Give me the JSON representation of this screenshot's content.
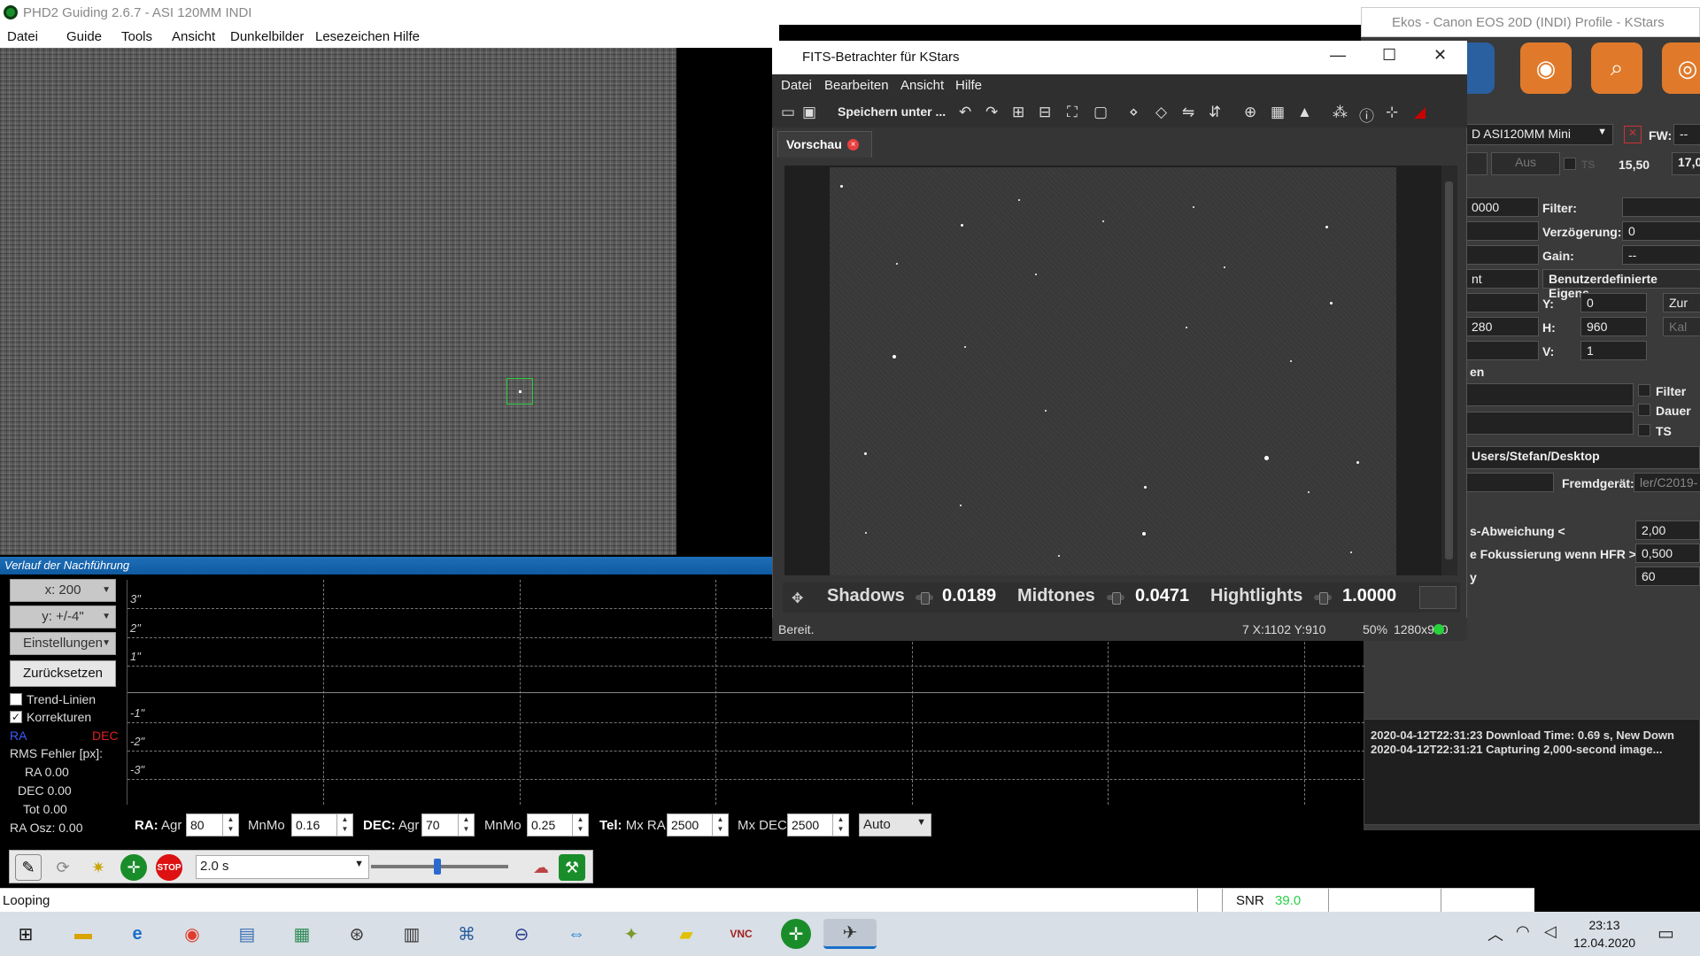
{
  "phd": {
    "title": "PHD2 Guiding 2.6.7 - ASI 120MM INDI",
    "menu": [
      "Datei",
      "Guide",
      "Tools",
      "Ansicht",
      "Dunkelbilder",
      "Lesezeichen",
      "Hilfe"
    ],
    "history_title": "Verlauf der Nachführung",
    "x_scale": "x: 200",
    "y_scale": "y: +/-4\"",
    "settings": "Einstellungen",
    "reset": "Zurücksetzen",
    "trend_lines": "Trend-Linien",
    "corrections": "Korrekturen",
    "ra_label": "RA",
    "dec_label": "DEC",
    "rms_label": "RMS Fehler [px]:",
    "rms_ra": "RA 0.00",
    "rms_dec": "DEC 0.00",
    "rms_tot": "Tot 0.00",
    "ra_osc": "RA Osz: 0.00",
    "y_ticks": [
      "3\"",
      "2\"",
      "1\"",
      "-1\"",
      "-2\"",
      "-3\""
    ],
    "params": {
      "ra": "RA:",
      "agr": "Agr",
      "ra_agr": "80",
      "mnmo": "MnMo",
      "ra_mnmo": "0.16",
      "dec": "DEC:",
      "dec_agr": "70",
      "dec_mnmo": "0.25",
      "tel": "Tel:",
      "mxra": "Mx RA",
      "mxra_val": "2500",
      "mxdec": "Mx DEC",
      "mxdec_val": "2500",
      "mode": "Auto"
    },
    "exposure": "2.0 s",
    "status": "Looping",
    "snr_label": "SNR",
    "snr_value": "39.0",
    "colors": {
      "ra": "#3b5bff",
      "dec": "#e02020",
      "snr": "#2bd14a"
    }
  },
  "fits": {
    "title": "FITS-Betrachter für KStars",
    "menu": [
      "Datei",
      "Bearbeiten",
      "Ansicht",
      "Hilfe"
    ],
    "save_as": "Speichern unter ...",
    "tab": "Vorschau",
    "shadows_label": "Shadows",
    "shadows": "0.0189",
    "midtones_label": "Midtones",
    "midtones": "0.0471",
    "highlights_label": "Hightlights",
    "highlights": "1.0000",
    "status_ready": "Bereit.",
    "status_coords": "7  X:1102 Y:910",
    "status_zoom": "50%",
    "status_size": "1280x960"
  },
  "ekos": {
    "title": "Ekos - Canon EOS 20D (INDI) Profile - KStars",
    "ccd": "D ASI120MM Mini",
    "fw": "FW:",
    "fw_val": "--",
    "aus": "Aus",
    "ts_small": "TS",
    "temp1": "15,50",
    "temp2": "17,0",
    "exp_val": "0000",
    "filter": "Filter:",
    "delay": "Verzögerung:",
    "delay_val": "0",
    "gain": "Gain:",
    "gain_val": "--",
    "custom_props": "Benutzerdefinierte Eigens",
    "y": "Y:",
    "y_val": "0",
    "h": "H:",
    "h_val": "960",
    "v": "V:",
    "v_val": "1",
    "w_val": "280",
    "reset": "Zur",
    "cal": "Kal",
    "en": "en",
    "filter_cb": "Filter",
    "dauer_cb": "Dauer",
    "ts_cb": "TS",
    "path": "Users/Stefan/Desktop",
    "ext_device": "Fremdgerät:",
    "ext_val": "ler/C2019-",
    "mode": "nt",
    "dev_label": "s-Abweichung <",
    "dev_val": "2,00",
    "hfr_label": "e Fokussierung wenn HFR >",
    "hfr_val": "0,500",
    "y_label": "y",
    "y2_val": "60",
    "log": [
      "2020-04-12T22:31:23 Download Time: 0.69 s, New Down",
      "2020-04-12T22:31:21 Capturing 2,000-second  image..."
    ]
  },
  "taskbar": {
    "time": "23:13",
    "date": "12.04.2020"
  }
}
